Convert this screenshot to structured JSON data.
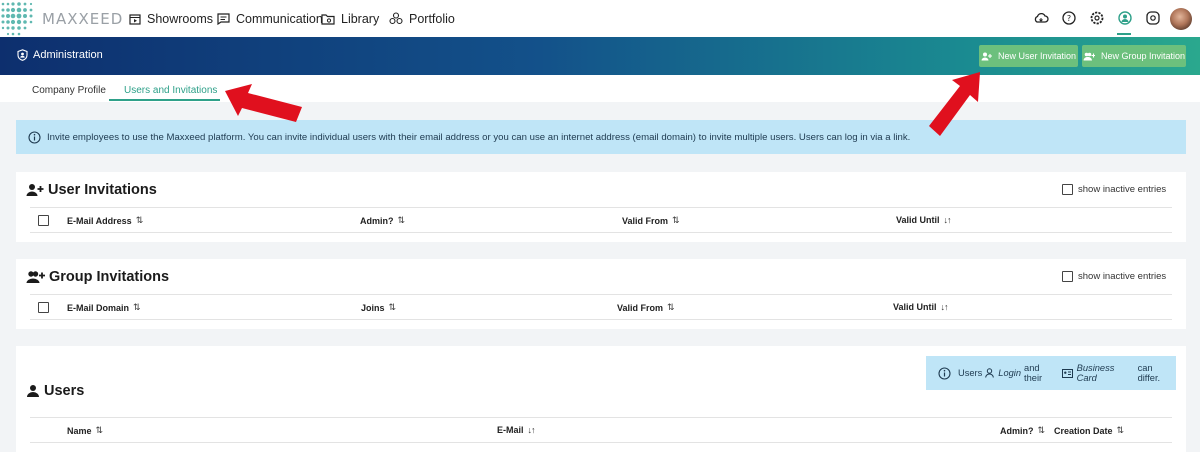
{
  "nav": {
    "logo_text": "MAXXEED",
    "items": [
      {
        "label": "Showrooms",
        "icon": "showroom-icon"
      },
      {
        "label": "Communication",
        "icon": "message-icon"
      },
      {
        "label": "Library",
        "icon": "folder-icon"
      },
      {
        "label": "Portfolio",
        "icon": "portfolio-icon"
      }
    ],
    "right_icons": [
      "cloud-icon",
      "help-icon",
      "settings-icon",
      "admin-icon",
      "gear-badge-icon",
      "avatar"
    ]
  },
  "admin_bar": {
    "title": "Administration",
    "buttons": {
      "new_user_invitation": "New User Invitation",
      "new_group_invitation": "New Group Invitation"
    }
  },
  "tabs": [
    {
      "label": "Company Profile",
      "active": false
    },
    {
      "label": "Users and Invitations",
      "active": true
    }
  ],
  "info_banner": "Invite employees to use the Maxxeed platform. You can invite individual users with their email address or you can use an internet address (email domain) to invite multiple users. Users can log in via a link.",
  "user_invitations": {
    "title": "User Invitations",
    "show_inactive": "show inactive entries",
    "columns": [
      {
        "label": "E-Mail Address",
        "sort": "⇅"
      },
      {
        "label": "Admin?",
        "sort": "⇅"
      },
      {
        "label": "Valid From",
        "sort": "⇅"
      },
      {
        "label": "Valid Until",
        "sort": "↓↑"
      }
    ]
  },
  "group_invitations": {
    "title": "Group Invitations",
    "show_inactive": "show inactive entries",
    "columns": [
      {
        "label": "E-Mail Domain",
        "sort": "⇅"
      },
      {
        "label": "Joins",
        "sort": "⇅"
      },
      {
        "label": "Valid From",
        "sort": "⇅"
      },
      {
        "label": "Valid Until",
        "sort": "↓↑"
      }
    ]
  },
  "users": {
    "title": "Users",
    "info_prefix": "Users",
    "info_login": "Login",
    "info_mid": "and their",
    "info_card": "Business Card",
    "info_suffix": "can differ.",
    "columns": [
      {
        "label": "Name",
        "sort": "⇅"
      },
      {
        "label": "E-Mail",
        "sort": "↓↑"
      },
      {
        "label": "Admin?",
        "sort": "⇅"
      },
      {
        "label": "Creation Date",
        "sort": "⇅"
      }
    ]
  },
  "colors": {
    "accent": "#2ea089",
    "button_green": "#6cc07d",
    "info_blue": "#bfe5f7",
    "annotation_red": "#e0101e"
  }
}
